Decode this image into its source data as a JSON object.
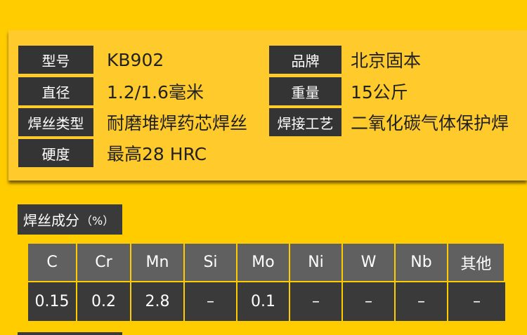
{
  "specs": [
    {
      "label": "型号",
      "value": "KB902"
    },
    {
      "label": "品牌",
      "value": "北京固本"
    },
    {
      "label": "直径",
      "value": "1.2/1.6毫米"
    },
    {
      "label": "重量",
      "value": "15公斤"
    },
    {
      "label": "焊丝类型",
      "value": "耐磨堆焊药芯焊丝"
    },
    {
      "label": "焊接工艺",
      "value": "二氧化碳气体保护焊"
    },
    {
      "label": "硬度",
      "value": "最高28 HRC"
    }
  ],
  "composition": {
    "title": "焊丝成分",
    "unit": "（%）",
    "headers": [
      "C",
      "Cr",
      "Mn",
      "Si",
      "Mo",
      "Ni",
      "W",
      "Nb",
      "其他"
    ],
    "values": [
      "0.15",
      "0.2",
      "2.8",
      "–",
      "0.1",
      "–",
      "–",
      "–",
      "–"
    ]
  },
  "colors": {
    "background": "#FFCC00",
    "label_bg": "#343434",
    "header_bg": "#606060",
    "cell_bg": "#3A3A3A"
  }
}
